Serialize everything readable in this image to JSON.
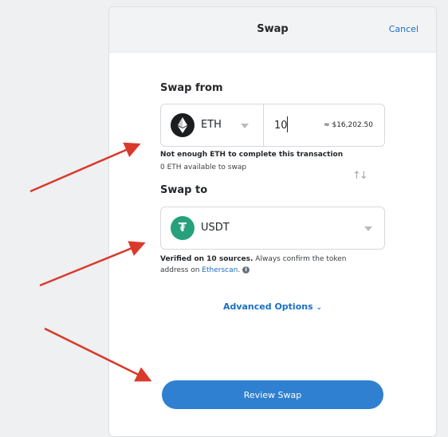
{
  "header": {
    "title": "Swap",
    "cancel_label": "Cancel"
  },
  "swap_from": {
    "label": "Swap from",
    "token": "ETH",
    "token_icon": "ethereum-logo",
    "amount": "10",
    "fiat_estimate": "≈ $16,202.50",
    "warning": "Not enough ETH to complete this transaction",
    "available": "0 ETH available to swap"
  },
  "swap_to": {
    "label": "Swap to",
    "token": "USDT",
    "token_icon": "tether-logo",
    "verified_strong": "Verified on 10 sources.",
    "verified_rest": " Always confirm the token address on ",
    "etherscan_label": "Etherscan",
    "verified_end": "."
  },
  "advanced_options_label": "Advanced Options",
  "review_button_label": "Review Swap",
  "colors": {
    "accent": "#2f80d0",
    "link": "#1a6fc4",
    "annotation_arrow": "#d93a2b",
    "tether": "#26a17b"
  }
}
